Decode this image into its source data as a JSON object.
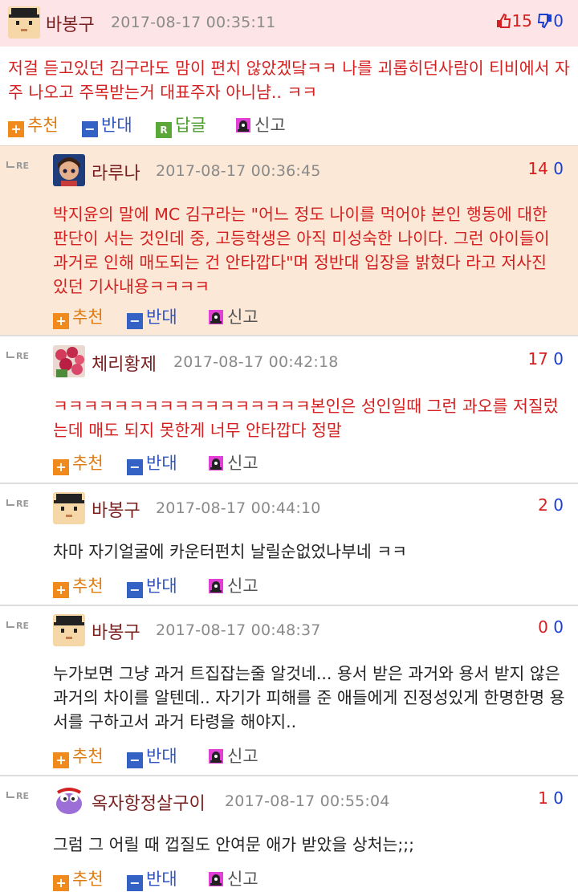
{
  "actions": {
    "recommend": "추천",
    "oppose": "반대",
    "reply": "답글",
    "report": "신고"
  },
  "re_label": "RE",
  "comments": [
    {
      "nick": "바봉구",
      "date": "2017-08-17 00:35:11",
      "up": "15",
      "down": "0",
      "text": "저걸 듣고있던 김구라도 맘이 편치 않았겠닼ㅋㅋ 나를 괴롭히던사람이 티비에서 자주 나오고 주목받는거 대표주자 아니냠.. ㅋㅋ"
    },
    {
      "nick": "라루나",
      "date": "2017-08-17 00:36:45",
      "up": "14",
      "down": "0",
      "text": "박지윤의 말에 MC 김구라는 \"어느 정도 나이를 먹어야 본인 행동에 대한 판단이 서는 것인데 중, 고등학생은 아직 미성숙한 나이다. 그런 아이들이 과거로 인해 매도되는 건 안타깝다\"며 정반대 입장을 밝혔다 라고 저사진 있던 기사내용ㅋㅋㅋㅋ"
    },
    {
      "nick": "체리황제",
      "date": "2017-08-17 00:42:18",
      "up": "17",
      "down": "0",
      "text": "ㅋㅋㅋㅋㅋㅋㅋㅋㅋㅋㅋㅋㅋㅋㅋㅋㅋ본인은 성인일때 그런 과오를 저질렀는데 매도 되지 못한게 너무 안타깝다 정말"
    },
    {
      "nick": "바봉구",
      "date": "2017-08-17 00:44:10",
      "up": "2",
      "down": "0",
      "text": "차마 자기얼굴에 카운터펀치 날릴순없었나부네 ㅋㅋ"
    },
    {
      "nick": "바봉구",
      "date": "2017-08-17 00:48:37",
      "up": "0",
      "down": "0",
      "text": "누가보면 그냥 과거 트집잡는줄 알것네... 용서 받은 과거와 용서 받지 않은 과거의 차이를 알텐데.. 자기가 피해를 준 애들에게 진정성있게 한명한명 용서를 구하고서 과거 타령을 해야지.."
    },
    {
      "nick": "옥자항정살구이",
      "date": "2017-08-17 00:55:04",
      "up": "1",
      "down": "0",
      "text": "그럼 그 어릴 때 껍질도 안여문 애가 받았을 상처는;;;"
    }
  ]
}
